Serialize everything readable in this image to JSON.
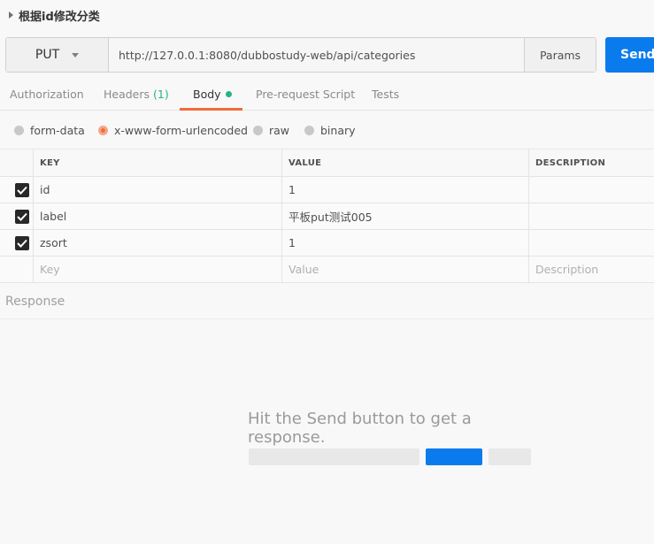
{
  "request": {
    "name": "根据id修改分类",
    "method": "PUT",
    "url": "http://127.0.0.1:8080/dubbostudy-web/api/categories",
    "params_label": "Params",
    "send_label": "Send"
  },
  "tabs": [
    {
      "label": "Authorization"
    },
    {
      "label": "Headers",
      "count": "(1)"
    },
    {
      "label": "Body",
      "active": true
    },
    {
      "label": "Pre-request Script"
    },
    {
      "label": "Tests"
    }
  ],
  "body_types": [
    {
      "label": "form-data",
      "selected": false
    },
    {
      "label": "x-www-form-urlencoded",
      "selected": true
    },
    {
      "label": "raw",
      "selected": false
    },
    {
      "label": "binary",
      "selected": false
    }
  ],
  "table": {
    "headers": {
      "key": "KEY",
      "value": "VALUE",
      "description": "DESCRIPTION"
    },
    "rows": [
      {
        "key": "id",
        "value": "1",
        "description": "",
        "checked": true
      },
      {
        "key": "label",
        "value": "平板put测试005",
        "description": "",
        "checked": true
      },
      {
        "key": "zsort",
        "value": "1",
        "description": "",
        "checked": true
      }
    ],
    "placeholders": {
      "key": "Key",
      "value": "Value",
      "description": "Description"
    }
  },
  "response": {
    "label": "Response",
    "empty_message": "Hit the Send button to get a response."
  },
  "colors": {
    "accent": "#f26b3a",
    "send": "#097bed",
    "success": "#26b47f"
  }
}
